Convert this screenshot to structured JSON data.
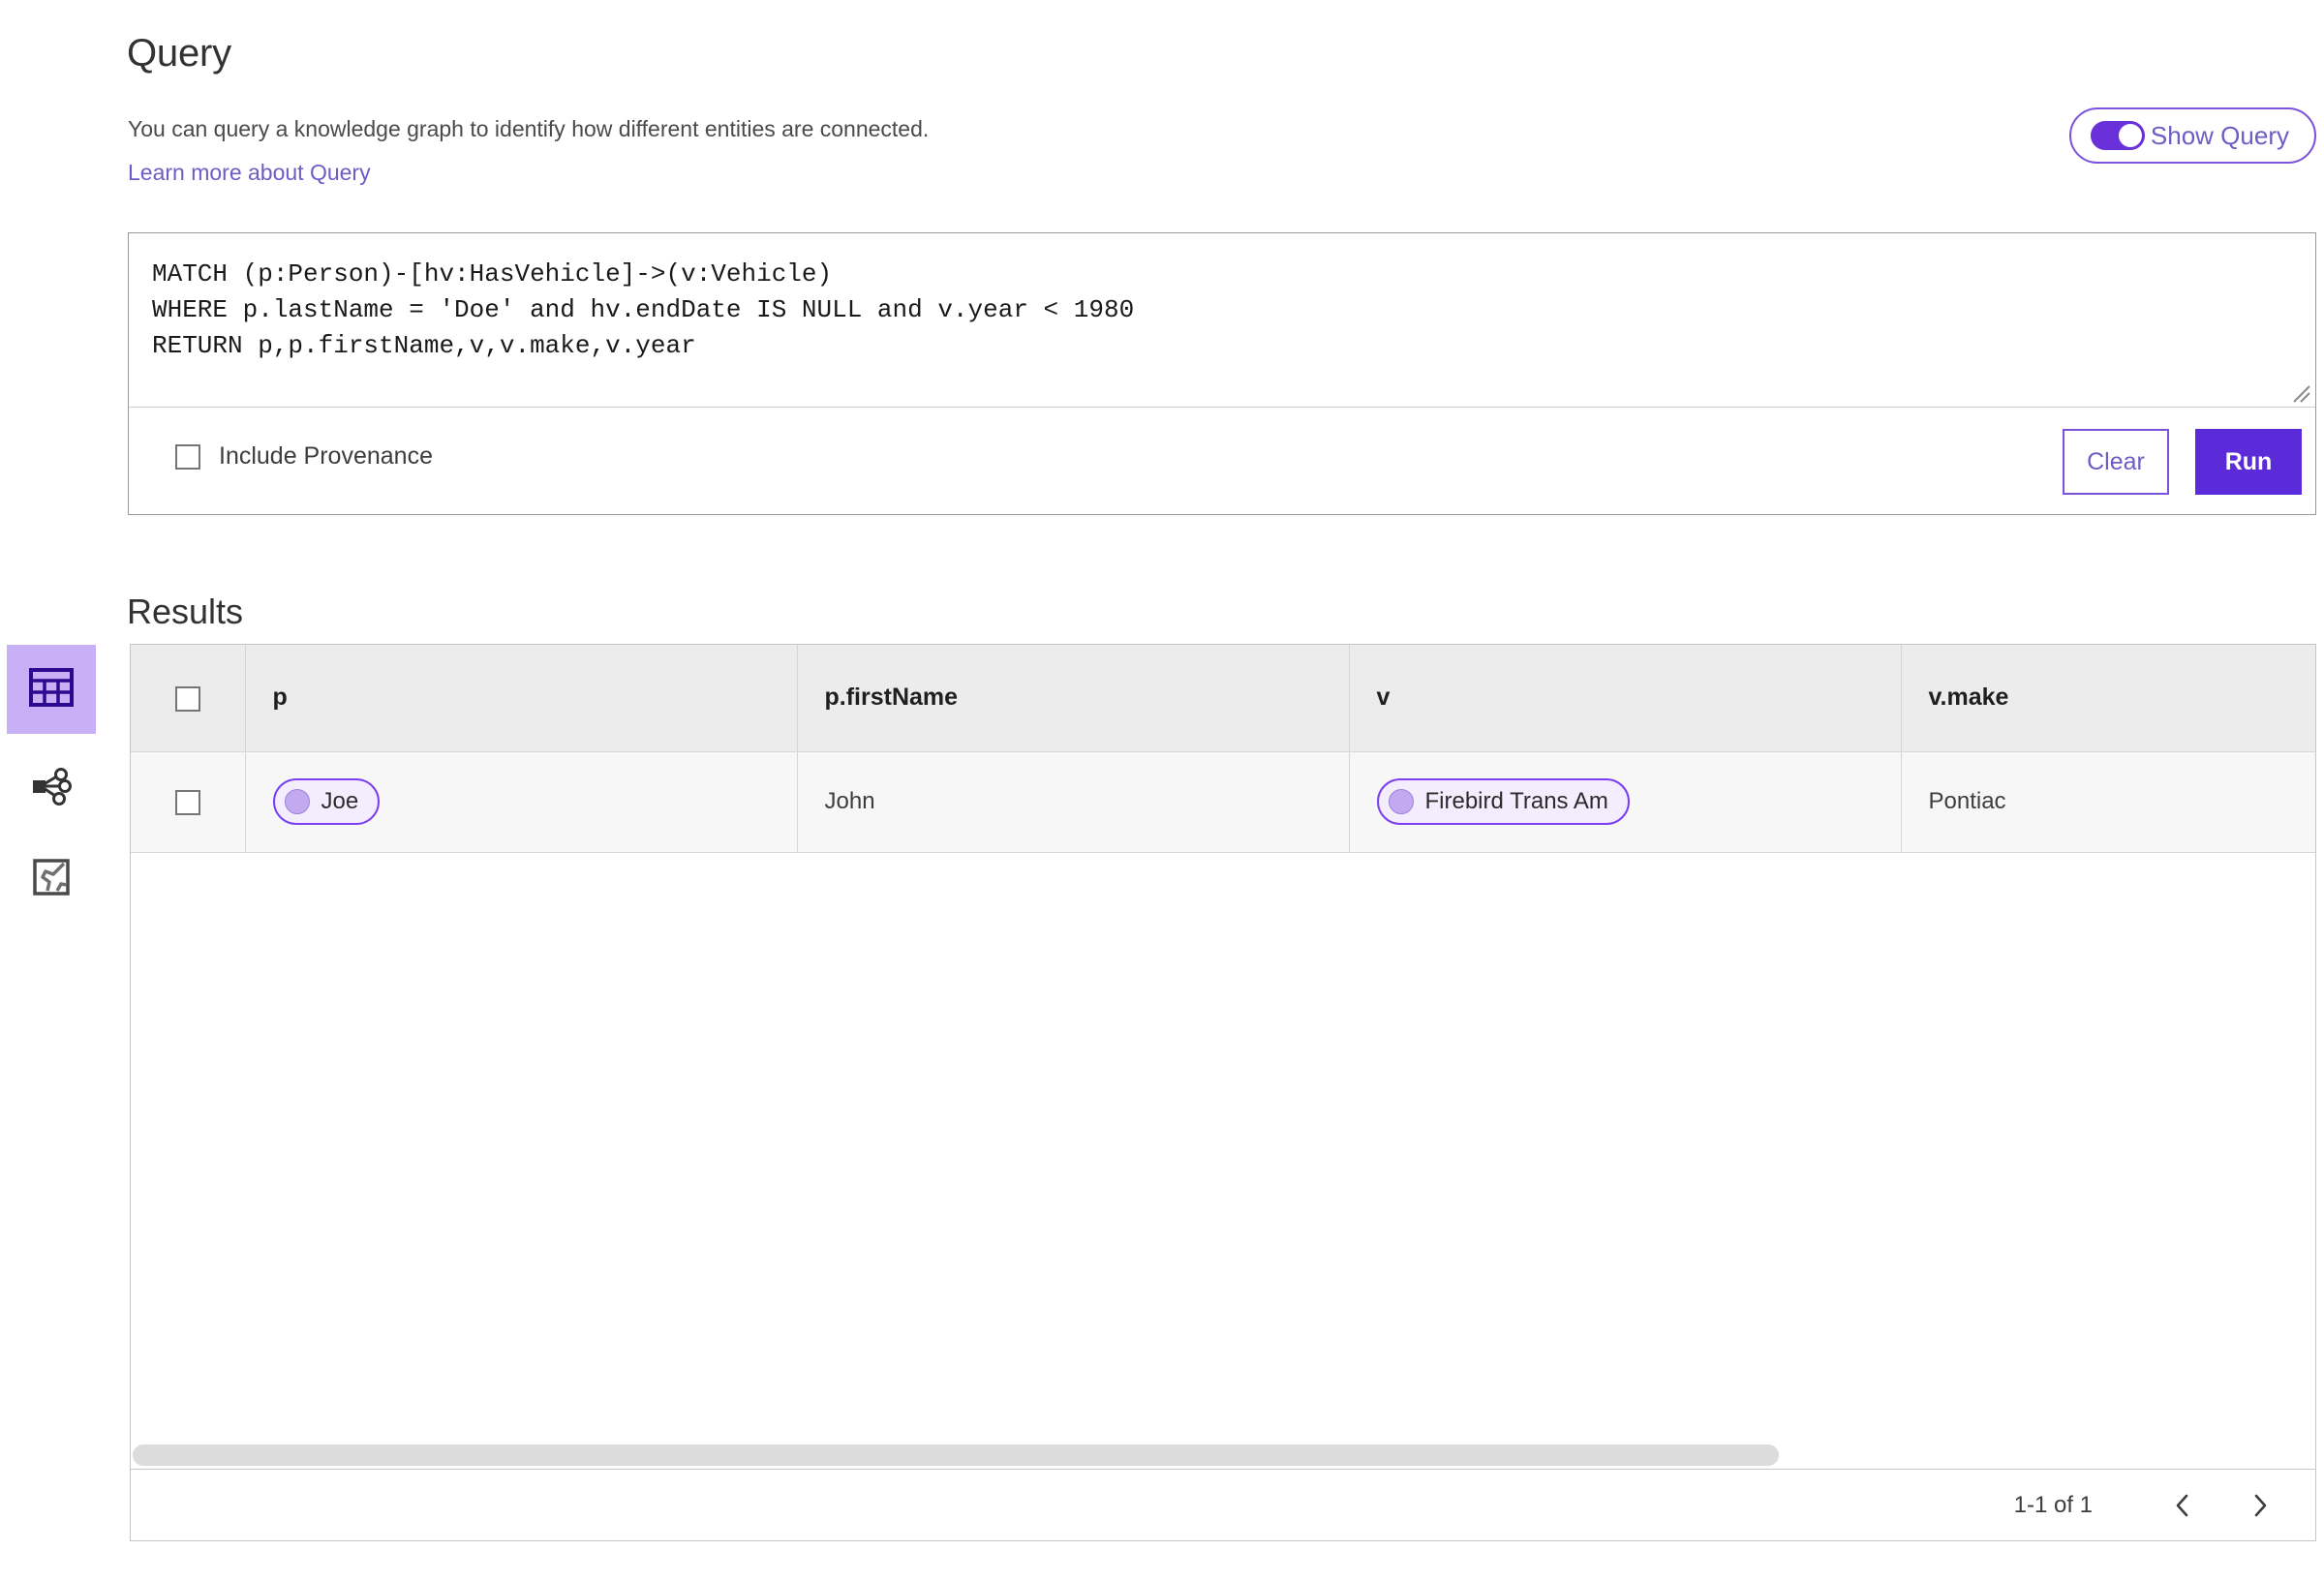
{
  "page": {
    "title": "Query",
    "description": "You can query a knowledge graph to identify how different entities are connected.",
    "learn_more_link": "Learn more about Query",
    "results_title": "Results"
  },
  "show_query_toggle": {
    "label": "Show Query",
    "state": "on",
    "accent_color": "#6930d9"
  },
  "query_editor": {
    "value": "MATCH (p:Person)-[hv:HasVehicle]->(v:Vehicle)\nWHERE p.lastName = 'Doe' and hv.endDate IS NULL and v.year < 1980\nRETURN p,p.firstName,v,v.make,v.year",
    "placeholder": "",
    "resize_grip": "resize-grip-icon"
  },
  "query_options": {
    "include_provenance_label": "Include Provenance",
    "include_provenance_checked": false
  },
  "actions": {
    "clear_label": "Clear",
    "run_label": "Run",
    "clear_color": "#6e5cc4",
    "run_background": "#5c2bd9"
  },
  "sidebar": {
    "items": [
      {
        "name": "table-view",
        "icon": "table-icon",
        "active": true
      },
      {
        "name": "graph-view",
        "icon": "graph-node-icon",
        "active": false
      },
      {
        "name": "map-view",
        "icon": "map-icon",
        "active": false
      }
    ],
    "active_background": "#c7b0f5"
  },
  "results_table": {
    "select_all_checked": false,
    "columns": [
      {
        "key": "checkbox",
        "label": ""
      },
      {
        "key": "p",
        "label": "p"
      },
      {
        "key": "p_firstName",
        "label": "p.firstName"
      },
      {
        "key": "v",
        "label": "v"
      },
      {
        "key": "v_make",
        "label": "v.make"
      }
    ],
    "rows": [
      {
        "selected": false,
        "p": {
          "type": "chip",
          "label": "Joe"
        },
        "p_firstName": "John",
        "v": {
          "type": "chip",
          "label": "Firebird Trans Am"
        },
        "v_make": "Pontiac"
      }
    ],
    "chip_border_color": "#7b3ff2",
    "chip_background": "#f3edfd",
    "header_background": "#ececec",
    "row_background": "#f7f7f7"
  },
  "pagination": {
    "range_label": "1-1 of 1",
    "prev_icon": "chevron-left-icon",
    "next_icon": "chevron-right-icon"
  }
}
